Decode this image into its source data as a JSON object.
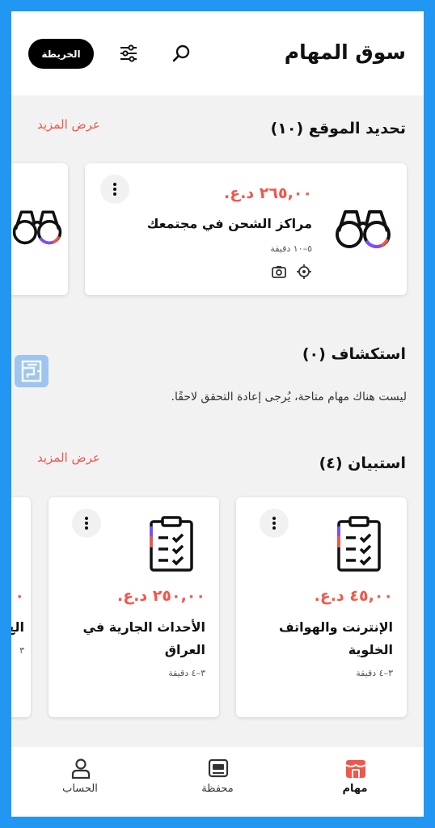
{
  "header": {
    "title": "سوق المهام",
    "map_button": "الخريطة"
  },
  "location_section": {
    "title": "تحديد الموقع (١٠)",
    "more": "عرض المزيد",
    "cards": [
      {
        "price": "٢٦٥,٠٠ د.ع.",
        "title": "مراكز الشحن في مجتمعك",
        "duration": "٥–١٠ دقيقة"
      }
    ]
  },
  "explore_section": {
    "title": "استكشاف (٠)",
    "empty_message": "ليست هناك مهام متاحة، يُرجى إعادة التحقق لاحقًا."
  },
  "survey_section": {
    "title": "استبيان (٤)",
    "more": "عرض المزيد",
    "cards": [
      {
        "price": "٤٥,٠٠ د.ع.",
        "title": "الإنترنت والهواتف الخلوية",
        "duration": "٣–٤ دقيقة"
      },
      {
        "price": "٢٥٠,٠٠ د.ع.",
        "title": "الأحداث الجارية في العراق",
        "duration": "٣–٤ دقيقة"
      }
    ],
    "partial": {
      "price": "٠",
      "title": "الع",
      "duration": "٣"
    }
  },
  "nav": {
    "tasks": "مهام",
    "wallet": "محفظة",
    "account": "الحساب"
  },
  "colors": {
    "accent": "#F2564A",
    "frame": "#2196F3",
    "background": "#F2F2F2"
  }
}
